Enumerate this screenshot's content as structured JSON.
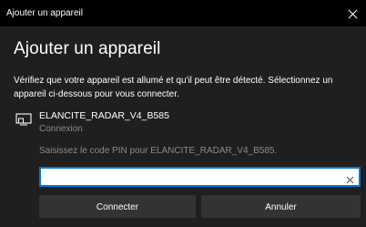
{
  "window": {
    "title": "Ajouter un appareil",
    "close_icon": "close-icon"
  },
  "heading": "Ajouter un appareil",
  "instructions": "Vérifiez que votre appareil est allumé et qu'il peut être détecté. Sélectionnez un appareil ci-dessous pour vous connecter.",
  "device": {
    "icon": "display-device-icon",
    "name": "ELANCITE_RADAR_V4_B585",
    "status": "Connexion"
  },
  "pin": {
    "prompt": "Saisissez le code PIN pour ELANCITE_RADAR_V4_B585.",
    "value": "",
    "clear_icon": "clear-icon"
  },
  "buttons": {
    "connect": "Connecter",
    "cancel": "Annuler"
  },
  "colors": {
    "background": "#1f1f1f",
    "titlebar": "#000000",
    "accent": "#0078d7",
    "button": "#333333",
    "secondary_text": "#8a8a8a"
  }
}
